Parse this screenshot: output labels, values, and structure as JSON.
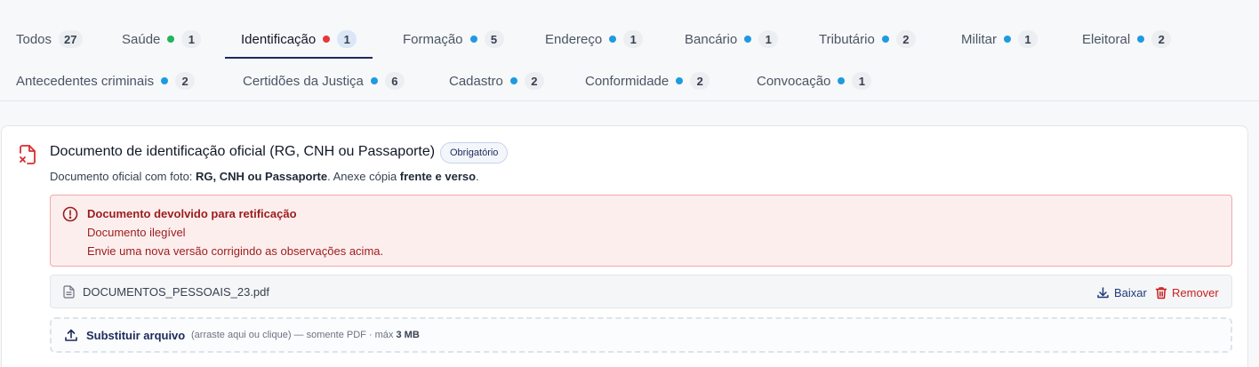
{
  "tabs": [
    {
      "label": "Todos",
      "count": "27",
      "dot": "none"
    },
    {
      "label": "Saúde",
      "count": "1",
      "dot": "green"
    },
    {
      "label": "Identificação",
      "count": "1",
      "dot": "red",
      "active": true
    },
    {
      "label": "Formação",
      "count": "5",
      "dot": "blue"
    },
    {
      "label": "Endereço",
      "count": "1",
      "dot": "blue"
    },
    {
      "label": "Bancário",
      "count": "1",
      "dot": "blue"
    },
    {
      "label": "Tributário",
      "count": "2",
      "dot": "blue"
    },
    {
      "label": "Militar",
      "count": "1",
      "dot": "blue"
    },
    {
      "label": "Eleitoral",
      "count": "2",
      "dot": "blue"
    },
    {
      "label": "Antecedentes criminais",
      "count": "2",
      "dot": "blue"
    },
    {
      "label": "Certidões da Justiça",
      "count": "6",
      "dot": "blue"
    },
    {
      "label": "Cadastro",
      "count": "2",
      "dot": "blue"
    },
    {
      "label": "Conformidade",
      "count": "2",
      "dot": "blue"
    },
    {
      "label": "Convocação",
      "count": "1",
      "dot": "blue"
    }
  ],
  "colors": {
    "accent": "#1e2a5a",
    "dot_blue": "#1e9be0",
    "dot_green": "#22b35e",
    "dot_red": "#e5383b",
    "error": "#9b1c1c",
    "remove": "#c81e1e"
  },
  "document": {
    "icon": "file-x-icon",
    "title": "Documento de identificação oficial (RG, CNH ou Passaporte)",
    "badge": "Obrigatório",
    "desc_prefix": "Documento oficial com foto: ",
    "desc_bold1": "RG, CNH ou Passaporte",
    "desc_mid": ". Anexe cópia ",
    "desc_bold2": "frente e verso",
    "desc_suffix": "."
  },
  "alert": {
    "icon": "alert-circle-icon",
    "title": "Documento devolvido para retificação",
    "reason": "Documento ilegível",
    "instruction": "Envie uma nova versão corrigindo as observações acima."
  },
  "file": {
    "icon": "file-text-icon",
    "name": "DOCUMENTOS_PESSOAIS_23.pdf",
    "download_label": "Baixar",
    "remove_label": "Remover"
  },
  "upload": {
    "icon": "upload-icon",
    "label": "Substituir arquivo",
    "hint_prefix": "(arraste aqui ou clique) — somente PDF · máx ",
    "hint_max": "3 MB"
  }
}
